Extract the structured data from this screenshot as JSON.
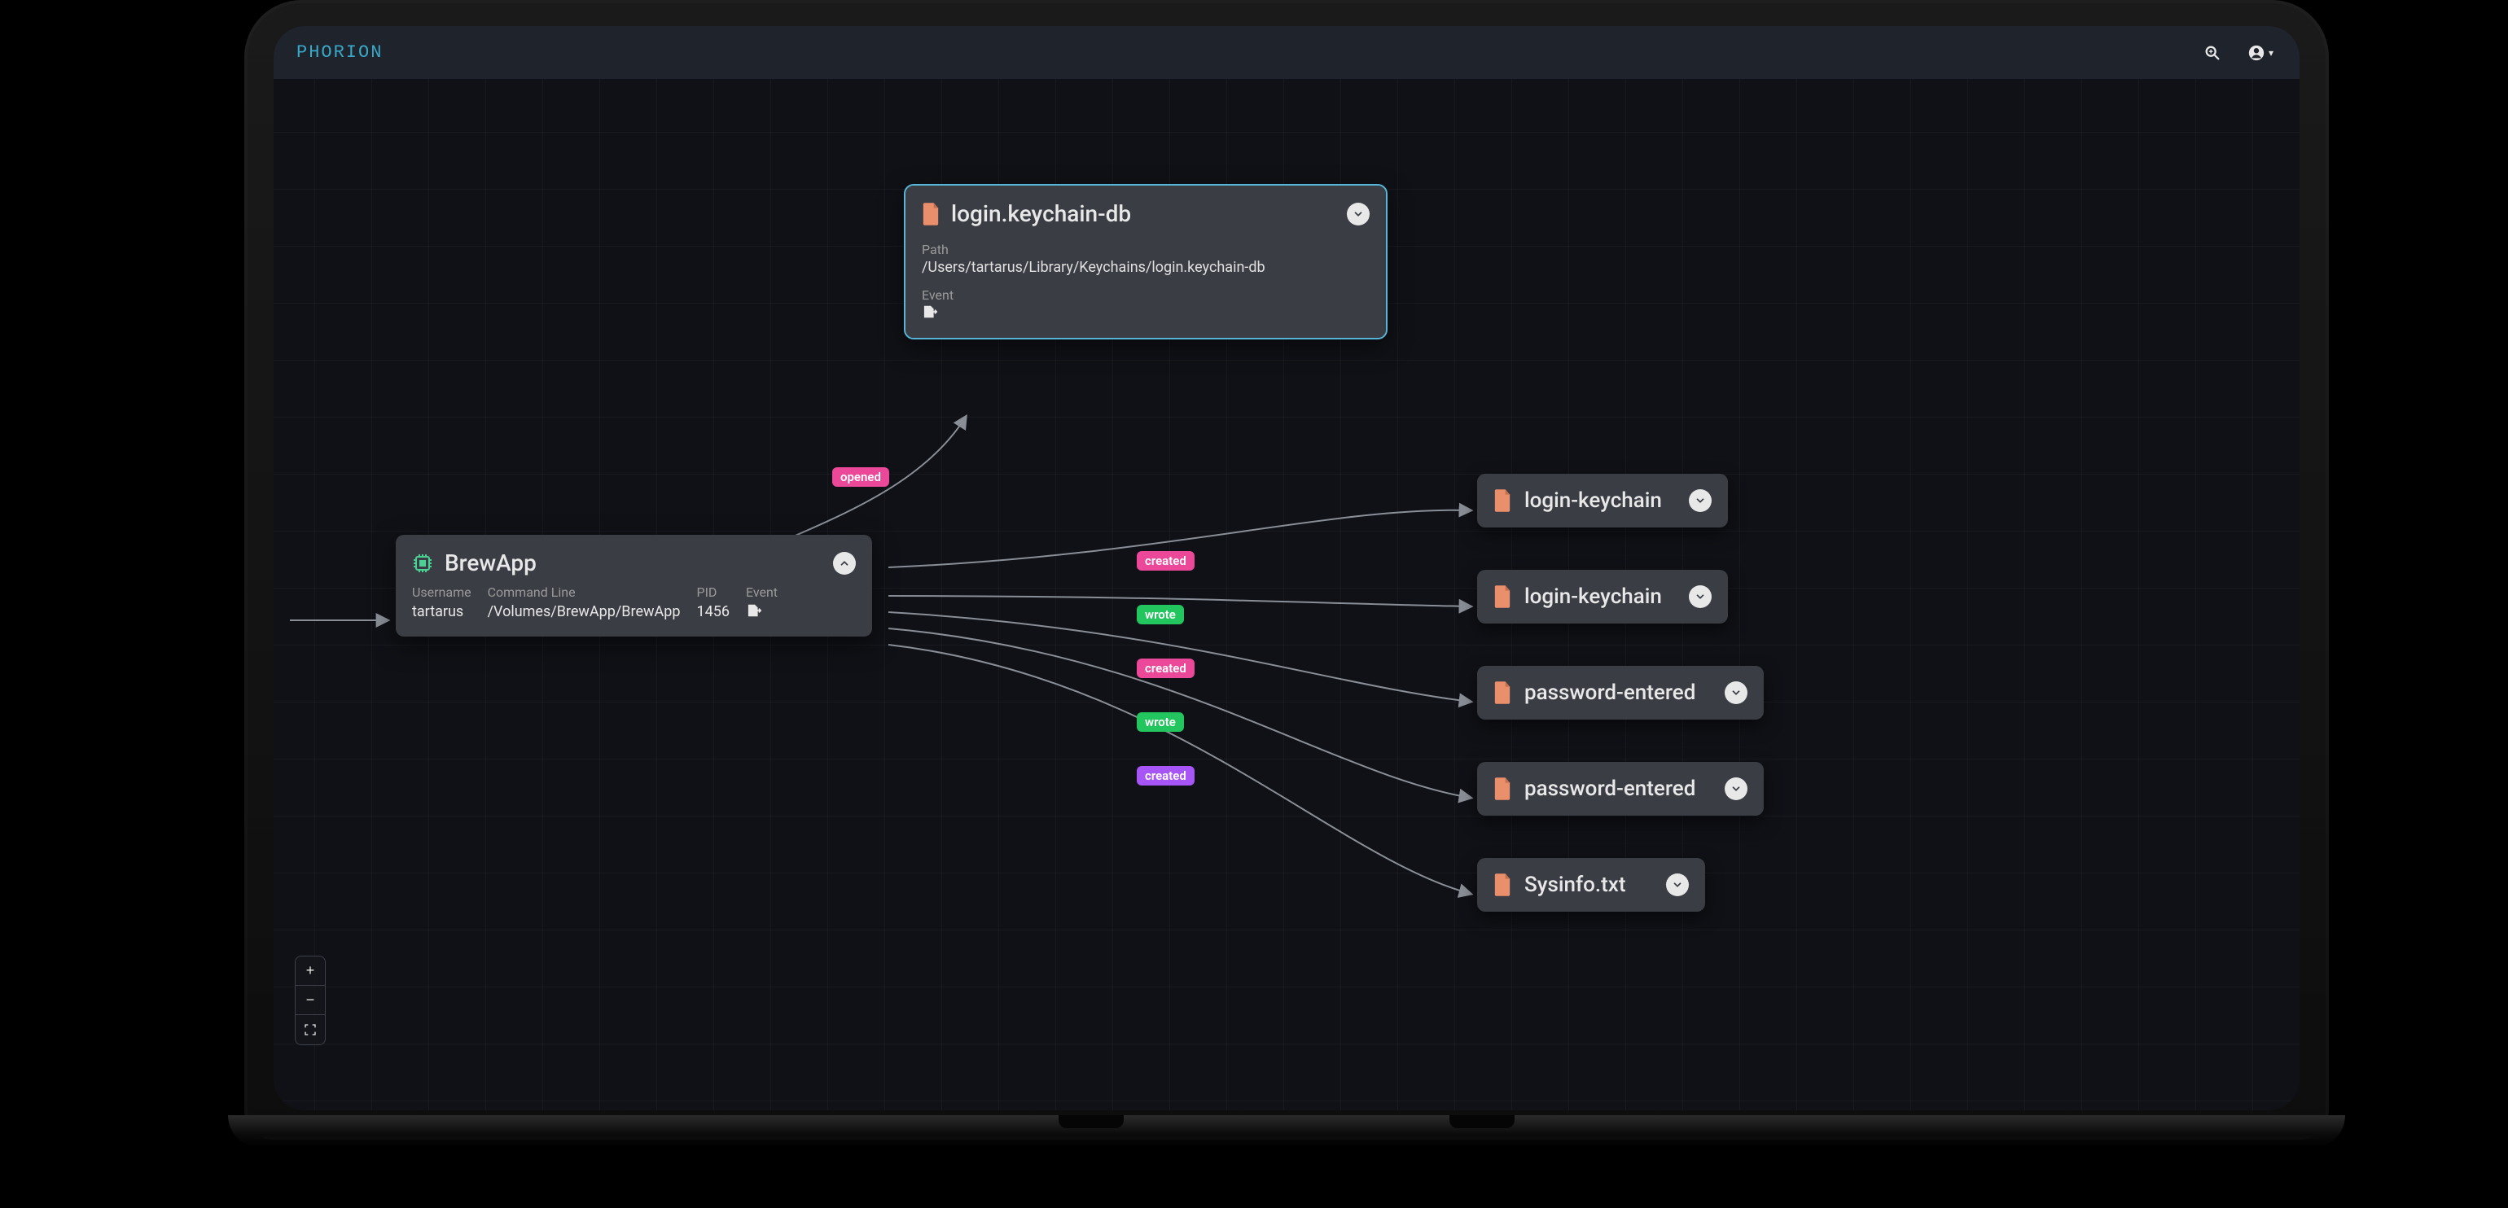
{
  "brand": "PHORION",
  "selected_node": {
    "type": "file",
    "title": "login.keychain-db",
    "path_label": "Path",
    "path": "/Users/tartarus/Library/Keychains/login.keychain-db",
    "event_label": "Event",
    "event_icon": "file-arrow-icon"
  },
  "process_node": {
    "title": "BrewApp",
    "username_label": "Username",
    "username": "tartarus",
    "cmd_label": "Command Line",
    "cmd": "/Volumes/BrewApp/BrewApp",
    "pid_label": "PID",
    "pid": "1456",
    "event_label": "Event",
    "event_icon": "file-arrow-icon"
  },
  "right_nodes": [
    {
      "title": "login-keychain"
    },
    {
      "title": "login-keychain"
    },
    {
      "title": "password-entered"
    },
    {
      "title": "password-entered"
    },
    {
      "title": "Sysinfo.txt"
    }
  ],
  "edge_labels": {
    "opened": "opened",
    "created": "created",
    "wrote": "wrote"
  }
}
